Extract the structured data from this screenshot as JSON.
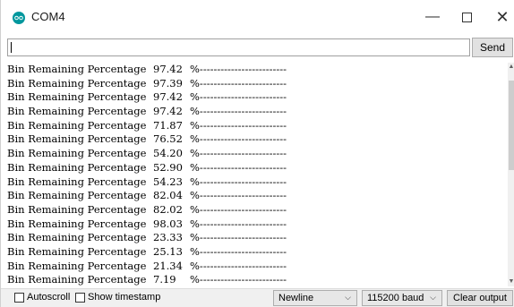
{
  "window": {
    "title": "COM4",
    "controls": {
      "minimize": "—",
      "close": "✕"
    }
  },
  "input_row": {
    "value": "",
    "send_label": "Send"
  },
  "output": {
    "lines": [
      {
        "label": "Bin Remaining Percentage",
        "value": "97.42",
        "suffix": "%-------------------------"
      },
      {
        "label": "Bin Remaining Percentage",
        "value": "97.39",
        "suffix": "%-------------------------"
      },
      {
        "label": "Bin Remaining Percentage",
        "value": "97.42",
        "suffix": "%-------------------------"
      },
      {
        "label": "Bin Remaining Percentage",
        "value": "97.42",
        "suffix": "%-------------------------"
      },
      {
        "label": "Bin Remaining Percentage",
        "value": "71.87",
        "suffix": "%-------------------------"
      },
      {
        "label": "Bin Remaining Percentage",
        "value": "76.52",
        "suffix": "%-------------------------"
      },
      {
        "label": "Bin Remaining Percentage",
        "value": "54.20",
        "suffix": "%-------------------------"
      },
      {
        "label": "Bin Remaining Percentage",
        "value": "52.90",
        "suffix": "%-------------------------"
      },
      {
        "label": "Bin Remaining Percentage",
        "value": "54.23",
        "suffix": "%-------------------------"
      },
      {
        "label": "Bin Remaining Percentage",
        "value": "82.04",
        "suffix": "%-------------------------"
      },
      {
        "label": "Bin Remaining Percentage",
        "value": "82.02",
        "suffix": "%-------------------------"
      },
      {
        "label": "Bin Remaining Percentage",
        "value": "98.03",
        "suffix": "%-------------------------"
      },
      {
        "label": "Bin Remaining Percentage",
        "value": "23.33",
        "suffix": "%-------------------------"
      },
      {
        "label": "Bin Remaining Percentage",
        "value": "25.13",
        "suffix": "%-------------------------"
      },
      {
        "label": "Bin Remaining Percentage",
        "value": "21.34",
        "suffix": "%-------------------------"
      },
      {
        "label": "Bin Remaining Percentage",
        "value": "7.19",
        "suffix": "%-------------------------"
      }
    ]
  },
  "bottom_bar": {
    "autoscroll_label": "Autoscroll",
    "autoscroll_checked": false,
    "timestamp_label": "Show timestamp",
    "timestamp_checked": false,
    "line_ending": "Newline",
    "baud_rate": "115200 baud",
    "clear_label": "Clear output"
  },
  "icons": {
    "app": "arduino-icon",
    "dropdown": "chevron-down-icon"
  },
  "colors": {
    "app_icon": "#00979d"
  }
}
